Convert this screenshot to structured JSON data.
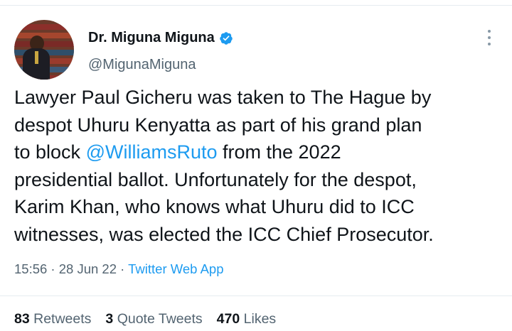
{
  "author": {
    "display_name": "Dr. Miguna Miguna",
    "handle": "@MigunaMiguna"
  },
  "tweet": {
    "line1": "Lawyer Paul Gicheru was taken to The Hague by",
    "line2": "despot Uhuru Kenyatta as part of his grand plan",
    "line3_pre": "to block ",
    "line3_mention": "@WilliamsRuto",
    "line3_post": " from the 2022",
    "line4": "presidential ballot. Unfortunately for the despot,",
    "line5": "Karim Khan, who knows what Uhuru did to ICC",
    "line6": "witnesses, was elected the ICC Chief Prosecutor."
  },
  "meta": {
    "time": "15:56",
    "date": "28 Jun 22",
    "separator": " · ",
    "source": "Twitter Web App"
  },
  "stats": {
    "retweets_count": "83",
    "retweets_label": "Retweets",
    "quotes_count": "3",
    "quotes_label": "Quote Tweets",
    "likes_count": "470",
    "likes_label": "Likes"
  },
  "colors": {
    "accent": "#1d9bf0",
    "text": "#0f1419",
    "muted": "#536471"
  },
  "icons": {
    "verified": "verified-badge-icon",
    "more": "more-options-icon"
  }
}
